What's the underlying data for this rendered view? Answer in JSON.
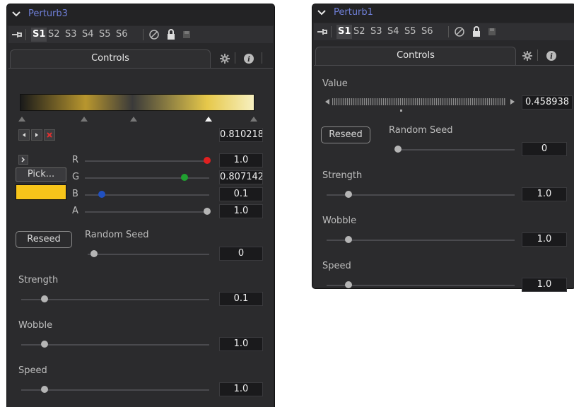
{
  "panel_left": {
    "title": "Perturb3",
    "slots": [
      "S1",
      "S2",
      "S3",
      "S4",
      "S5",
      "S6"
    ],
    "tab": "Controls",
    "gradient": {
      "colors": [
        "#1a1a1a",
        "#b8962e",
        "#3a3a3a",
        "#e6c84a",
        "#f7f0c0"
      ],
      "selected_value": "0.810218"
    },
    "rgba": {
      "r_label": "R",
      "r_value": "1.0",
      "r_level": 1.0,
      "r_color": "#e02020",
      "g_label": "G",
      "g_value": "0.807142",
      "g_level": 0.807142,
      "g_color": "#20a030",
      "b_label": "B",
      "b_value": "0.1",
      "b_level": 0.1,
      "b_color": "#2050c0",
      "a_label": "A",
      "a_value": "1.0",
      "a_level": 1.0,
      "a_color": "#b5b5b5",
      "pick_label": "Pick...",
      "swatch_color": "#f7c51a"
    },
    "reseed_label": "Reseed",
    "random_seed_label": "Random Seed",
    "random_seed_value": "0",
    "strength_label": "Strength",
    "strength_value": "0.1",
    "wobble_label": "Wobble",
    "wobble_value": "1.0",
    "speed_label": "Speed",
    "speed_value": "1.0"
  },
  "panel_right": {
    "title": "Perturb1",
    "slots": [
      "S1",
      "S2",
      "S3",
      "S4",
      "S5",
      "S6"
    ],
    "tab": "Controls",
    "value_label": "Value",
    "value_value": "0.458938",
    "reseed_label": "Reseed",
    "random_seed_label": "Random Seed",
    "random_seed_value": "0",
    "strength_label": "Strength",
    "strength_value": "1.0",
    "wobble_label": "Wobble",
    "wobble_value": "1.0",
    "speed_label": "Speed",
    "speed_value": "1.0"
  },
  "colors": {
    "title": "#6f7fd8",
    "panel_bg": "#28282a"
  }
}
